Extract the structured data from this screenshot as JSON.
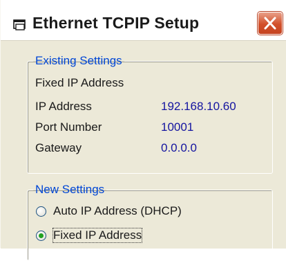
{
  "window": {
    "title": "Ethernet TCPIP Setup"
  },
  "icons": {
    "app": "window-icon",
    "close": "close-icon"
  },
  "existing": {
    "legend": "Existing Settings",
    "mode": "Fixed IP Address",
    "rows": [
      {
        "label": "IP Address",
        "value": "192.168.10.60"
      },
      {
        "label": "Port Number",
        "value": "10001"
      },
      {
        "label": "Gateway",
        "value": "0.0.0.0"
      }
    ]
  },
  "new_settings": {
    "legend": "New Settings",
    "options": [
      {
        "label": "Auto IP Address (DHCP)",
        "selected": false
      },
      {
        "label": "Fixed IP Address",
        "selected": true
      }
    ]
  },
  "colors": {
    "legend": "#0046d5",
    "value": "#1414a0",
    "radio_dot": "#21a121",
    "close_button": "#d2502a",
    "dialog_face": "#ece9d8"
  }
}
